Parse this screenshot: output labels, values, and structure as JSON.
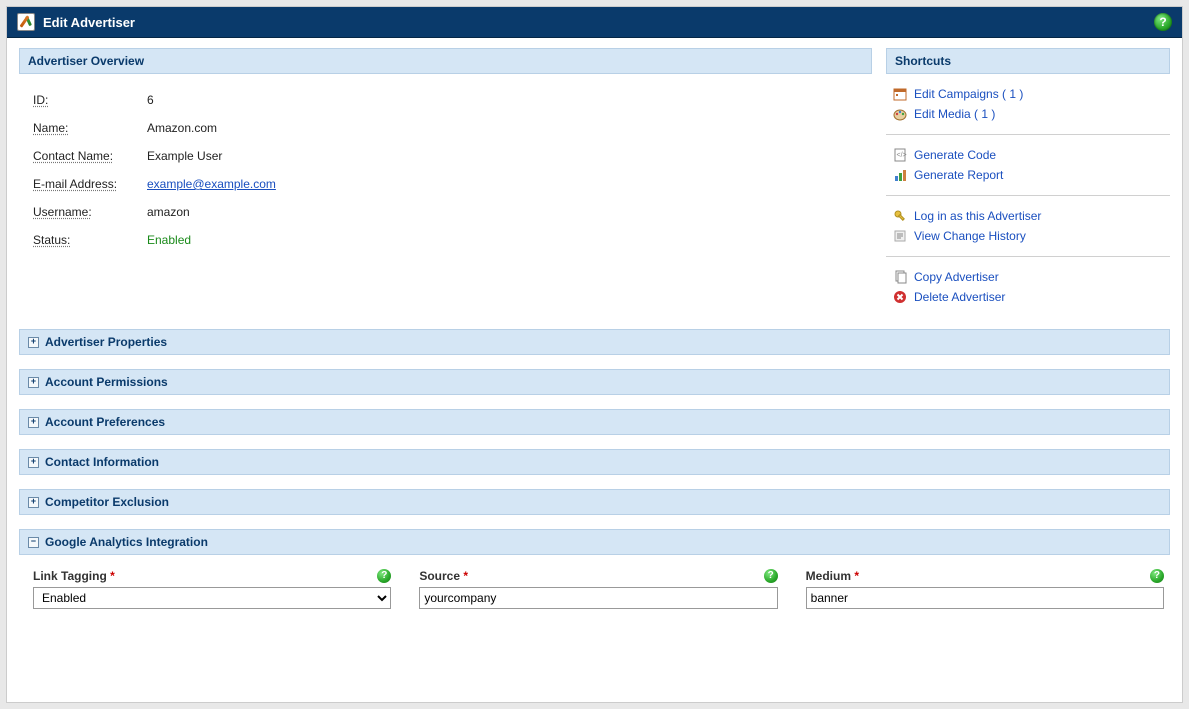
{
  "title": "Edit Advertiser",
  "overview": {
    "header": "Advertiser Overview",
    "rows": {
      "id_label": "ID:",
      "id_value": "6",
      "name_label": "Name:",
      "name_value": "Amazon.com",
      "contact_label": "Contact Name:",
      "contact_value": "Example User",
      "email_label": "E-mail Address:",
      "email_value": "example@example.com",
      "username_label": "Username:",
      "username_value": "amazon",
      "status_label": "Status:",
      "status_value": "Enabled"
    }
  },
  "shortcuts": {
    "header": "Shortcuts",
    "items": {
      "edit_campaigns": "Edit Campaigns ( 1 )",
      "edit_media": "Edit Media ( 1 )",
      "gen_code": "Generate Code",
      "gen_report": "Generate Report",
      "login_as": "Log in as this Advertiser",
      "change_history": "View Change History",
      "copy": "Copy Advertiser",
      "delete": "Delete Advertiser"
    }
  },
  "sections": {
    "advertiser_properties": "Advertiser Properties",
    "account_permissions": "Account Permissions",
    "account_preferences": "Account Preferences",
    "contact_information": "Contact Information",
    "competitor_exclusion": "Competitor Exclusion",
    "ga_integration": "Google Analytics Integration"
  },
  "ga": {
    "link_tagging_label": "Link Tagging",
    "link_tagging_value": "Enabled",
    "source_label": "Source",
    "source_value": "yourcompany",
    "medium_label": "Medium",
    "medium_value": "banner"
  }
}
